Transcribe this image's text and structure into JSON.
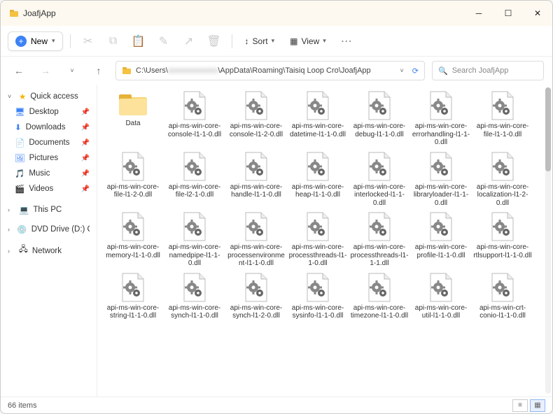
{
  "window": {
    "title": "JoafjApp"
  },
  "toolbar": {
    "new_label": "New",
    "sort_label": "Sort",
    "view_label": "View"
  },
  "address": {
    "path_prefix": "C:\\Users\\",
    "path_blur": "xxxxxxxxxxxxx",
    "path_suffix": "\\AppData\\Roaming\\Taisiq Loop Cro\\JoafjApp"
  },
  "search": {
    "placeholder": "Search JoafjApp"
  },
  "sidebar": {
    "quick": "Quick access",
    "items": [
      {
        "label": "Desktop"
      },
      {
        "label": "Downloads"
      },
      {
        "label": "Documents"
      },
      {
        "label": "Pictures"
      },
      {
        "label": "Music"
      },
      {
        "label": "Videos"
      }
    ],
    "thispc": "This PC",
    "dvd": "DVD Drive (D:) CCCC",
    "network": "Network"
  },
  "files": [
    {
      "name": "Data",
      "type": "folder"
    },
    {
      "name": "api-ms-win-core-console-l1-1-0.dll",
      "type": "dll"
    },
    {
      "name": "api-ms-win-core-console-l1-2-0.dll",
      "type": "dll"
    },
    {
      "name": "api-ms-win-core-datetime-l1-1-0.dll",
      "type": "dll"
    },
    {
      "name": "api-ms-win-core-debug-l1-1-0.dll",
      "type": "dll"
    },
    {
      "name": "api-ms-win-core-errorhandling-l1-1-0.dll",
      "type": "dll"
    },
    {
      "name": "api-ms-win-core-file-l1-1-0.dll",
      "type": "dll"
    },
    {
      "name": "api-ms-win-core-file-l1-2-0.dll",
      "type": "dll"
    },
    {
      "name": "api-ms-win-core-file-l2-1-0.dll",
      "type": "dll"
    },
    {
      "name": "api-ms-win-core-handle-l1-1-0.dll",
      "type": "dll"
    },
    {
      "name": "api-ms-win-core-heap-l1-1-0.dll",
      "type": "dll"
    },
    {
      "name": "api-ms-win-core-interlocked-l1-1-0.dll",
      "type": "dll"
    },
    {
      "name": "api-ms-win-core-libraryloader-l1-1-0.dll",
      "type": "dll"
    },
    {
      "name": "api-ms-win-core-localization-l1-2-0.dll",
      "type": "dll"
    },
    {
      "name": "api-ms-win-core-memory-l1-1-0.dll",
      "type": "dll"
    },
    {
      "name": "api-ms-win-core-namedpipe-l1-1-0.dll",
      "type": "dll"
    },
    {
      "name": "api-ms-win-core-processenvironment-l1-1-0.dll",
      "type": "dll"
    },
    {
      "name": "api-ms-win-core-processthreads-l1-1-0.dll",
      "type": "dll"
    },
    {
      "name": "api-ms-win-core-processthreads-l1-1-1.dll",
      "type": "dll"
    },
    {
      "name": "api-ms-win-core-profile-l1-1-0.dll",
      "type": "dll"
    },
    {
      "name": "api-ms-win-core-rtlsupport-l1-1-0.dll",
      "type": "dll"
    },
    {
      "name": "api-ms-win-core-string-l1-1-0.dll",
      "type": "dll"
    },
    {
      "name": "api-ms-win-core-synch-l1-1-0.dll",
      "type": "dll"
    },
    {
      "name": "api-ms-win-core-synch-l1-2-0.dll",
      "type": "dll"
    },
    {
      "name": "api-ms-win-core-sysinfo-l1-1-0.dll",
      "type": "dll"
    },
    {
      "name": "api-ms-win-core-timezone-l1-1-0.dll",
      "type": "dll"
    },
    {
      "name": "api-ms-win-core-util-l1-1-0.dll",
      "type": "dll"
    },
    {
      "name": "api-ms-win-crt-conio-l1-1-0.dll",
      "type": "dll"
    }
  ],
  "status": {
    "count_label": "66 items"
  }
}
